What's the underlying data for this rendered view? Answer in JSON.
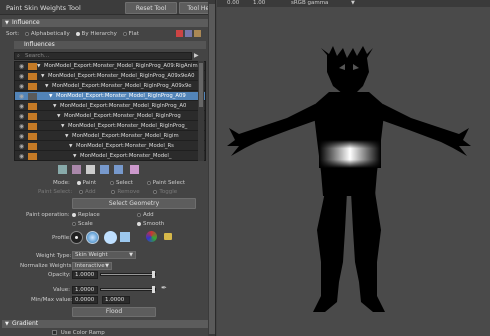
{
  "window": {
    "title": "Paint Skin Weights Tool",
    "reset_label": "Reset Tool",
    "help_label": "Tool Help"
  },
  "influence_section": {
    "header": "Influence",
    "sort_label": "Sort:",
    "sort_options": [
      "Alphabetically",
      "By Hierarchy",
      "Flat"
    ],
    "sort_selected": "By Hierarchy",
    "influences_header": "Influences",
    "search_placeholder": "Search...",
    "items": [
      {
        "label": "MonModel_Export:Monster_Model_RigInProg_A09:RigAnim",
        "indent": 22,
        "selected": false
      },
      {
        "label": "MonModel_Export:Monster_Model_RigInProg_A09x9eA0",
        "indent": 26,
        "selected": false
      },
      {
        "label": "MonModel_Export:Monster_Model_RigInProg_A09x9e",
        "indent": 30,
        "selected": false
      },
      {
        "label": "MonModel_Export:Monster_Model_RigInProg_A09",
        "indent": 34,
        "selected": true
      },
      {
        "label": "MonModel_Export:Monster_Model_RigInProg_A0",
        "indent": 38,
        "selected": false
      },
      {
        "label": "MonModel_Export:Monster_Model_RigInProg",
        "indent": 42,
        "selected": false
      },
      {
        "label": "MonModel_Export:Monster_Model_RigInProg_",
        "indent": 46,
        "selected": false
      },
      {
        "label": "MonModel_Export:Monster_Model_Rigim",
        "indent": 50,
        "selected": false
      },
      {
        "label": "MonModel_Export:Monster_Model_Rs",
        "indent": 54,
        "selected": false
      },
      {
        "label": "MonModel_Export:Monster_Model_",
        "indent": 58,
        "selected": false
      }
    ]
  },
  "mode": {
    "label": "Mode:",
    "options": [
      "Paint",
      "Select",
      "Paint Select"
    ],
    "selected": "Paint",
    "paint_select_label": "Paint Select:",
    "paint_select_options": [
      "Add",
      "Remove",
      "Toggle"
    ],
    "select_geometry": "Select Geometry"
  },
  "paint_operation": {
    "label": "Paint operation:",
    "options": [
      "Replace",
      "Add",
      "Scale",
      "Smooth"
    ],
    "selected": "Replace"
  },
  "profile": {
    "label": "Profile:"
  },
  "weights": {
    "weight_type_label": "Weight Type:",
    "weight_type_value": "Skin Weight",
    "normalize_label": "Normalize Weights:",
    "normalize_value": "Interactive",
    "opacity_label": "Opacity:",
    "opacity_value": "1.0000",
    "opacity_level": 1.0,
    "value_label": "Value:",
    "value_value": "1.0000",
    "value_level": 1.0,
    "minmax_label": "Min/Max value:",
    "min_value": "0.0000",
    "max_value": "1.0000",
    "flood_label": "Flood"
  },
  "gradient_section": {
    "header": "Gradient",
    "use_color_ramp": "Use Color Ramp"
  },
  "viewport": {
    "val_a": "0.00",
    "val_b": "1.00",
    "color_space": "sRGB gamma"
  }
}
